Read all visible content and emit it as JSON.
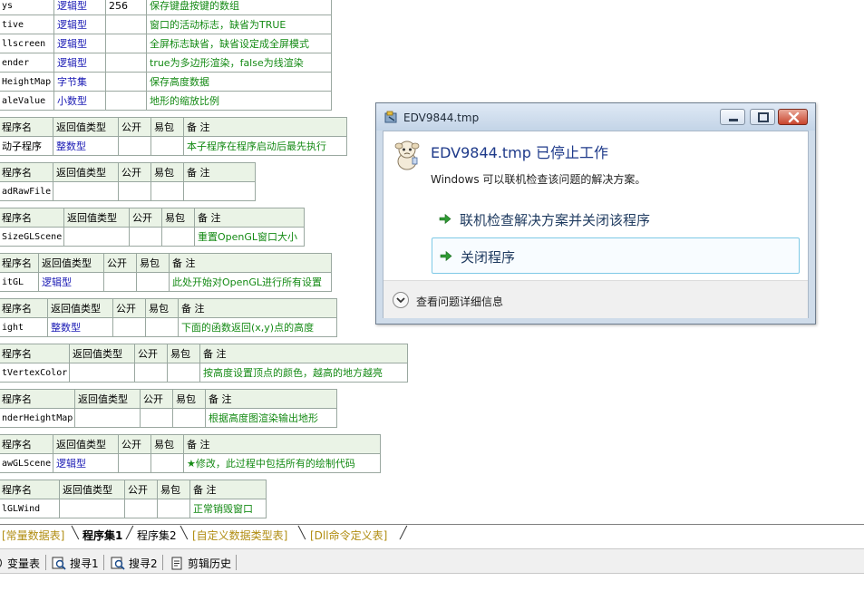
{
  "code_grids": {
    "top_rows": [
      {
        "name": "ys",
        "type": "逻辑型",
        "extra": "256",
        "note": "保存键盘按键的数组"
      },
      {
        "name": "tive",
        "type": "逻辑型",
        "extra": "",
        "note": "窗口的活动标志，缺省为TRUE"
      },
      {
        "name": "llscreen",
        "type": "逻辑型",
        "extra": "",
        "note": "全屏标志缺省，缺省设定成全屏模式"
      },
      {
        "name": "ender",
        "type": "逻辑型",
        "extra": "",
        "note": "true为多边形渲染，false为线渲染"
      },
      {
        "name": "HeightMap",
        "type": "字节集",
        "extra": "",
        "note": "保存高度数据"
      },
      {
        "name": "aleValue",
        "type": "小数型",
        "extra": "",
        "note": "地形的缩放比例"
      }
    ],
    "headers": {
      "name": "程序名",
      "return_type": "返回值类型",
      "public": "公开",
      "package": "易包",
      "note": "备 注"
    },
    "subs": [
      {
        "name": "动子程序",
        "type": "整数型",
        "note": "本子程序在程序启动后最先执行"
      },
      {
        "name": "adRawFile",
        "type": "",
        "note": ""
      },
      {
        "name": "SizeGLScene",
        "type": "",
        "note": "重置OpenGL窗口大小"
      },
      {
        "name": "itGL",
        "type": "逻辑型",
        "note": "此处开始对OpenGL进行所有设置"
      },
      {
        "name": "ight",
        "type": "整数型",
        "note": "下面的函数返回(x,y)点的高度"
      },
      {
        "name": "tVertexColor",
        "type": "",
        "note": "按高度设置顶点的颜色，越高的地方越亮"
      },
      {
        "name": "nderHeightMap",
        "type": "",
        "note": "根据高度图渲染输出地形"
      },
      {
        "name": "awGLScene",
        "type": "逻辑型",
        "note": "★修改，此过程中包括所有的绘制代码"
      },
      {
        "name": "lGLWind",
        "type": "",
        "note": "正常销毁窗口"
      }
    ]
  },
  "dialog": {
    "title": "EDV9844.tmp",
    "heading": "EDV9844.tmp 已停止工作",
    "description": "Windows 可以联机检查该问题的解决方案。",
    "option_online": "联机检查解决方案并关闭该程序",
    "option_close": "关闭程序",
    "details": "查看问题详细信息"
  },
  "tabs": [
    {
      "label": "[常量数据表]",
      "style": "gold"
    },
    {
      "label": "程序集1",
      "style": "active"
    },
    {
      "label": "程序集2",
      "style": "plain"
    },
    {
      "label": "[自定义数据类型表]",
      "style": "gold"
    },
    {
      "label": "[Dll命令定义表]",
      "style": "gold"
    }
  ],
  "toolbar": {
    "variables": "变量表",
    "search1": "搜寻1",
    "search2": "搜寻2",
    "clip_history": "剪辑历史"
  },
  "colors": {
    "header_bg": "#eaf3e6",
    "type_text": "#1a1ab4",
    "note_text": "#148a14",
    "tab_gold": "#b08c10",
    "dialog_link": "#1e3a8a"
  },
  "icons": {
    "dialog_app": "app-icon",
    "dialog_mascot": "crashed-mascot-icon",
    "commands": "green-arrow-icon",
    "details": "chevron-down-circle-icon",
    "toolbar": [
      "variables-icon",
      "search-icon",
      "search-icon",
      "clipboard-icon"
    ]
  }
}
